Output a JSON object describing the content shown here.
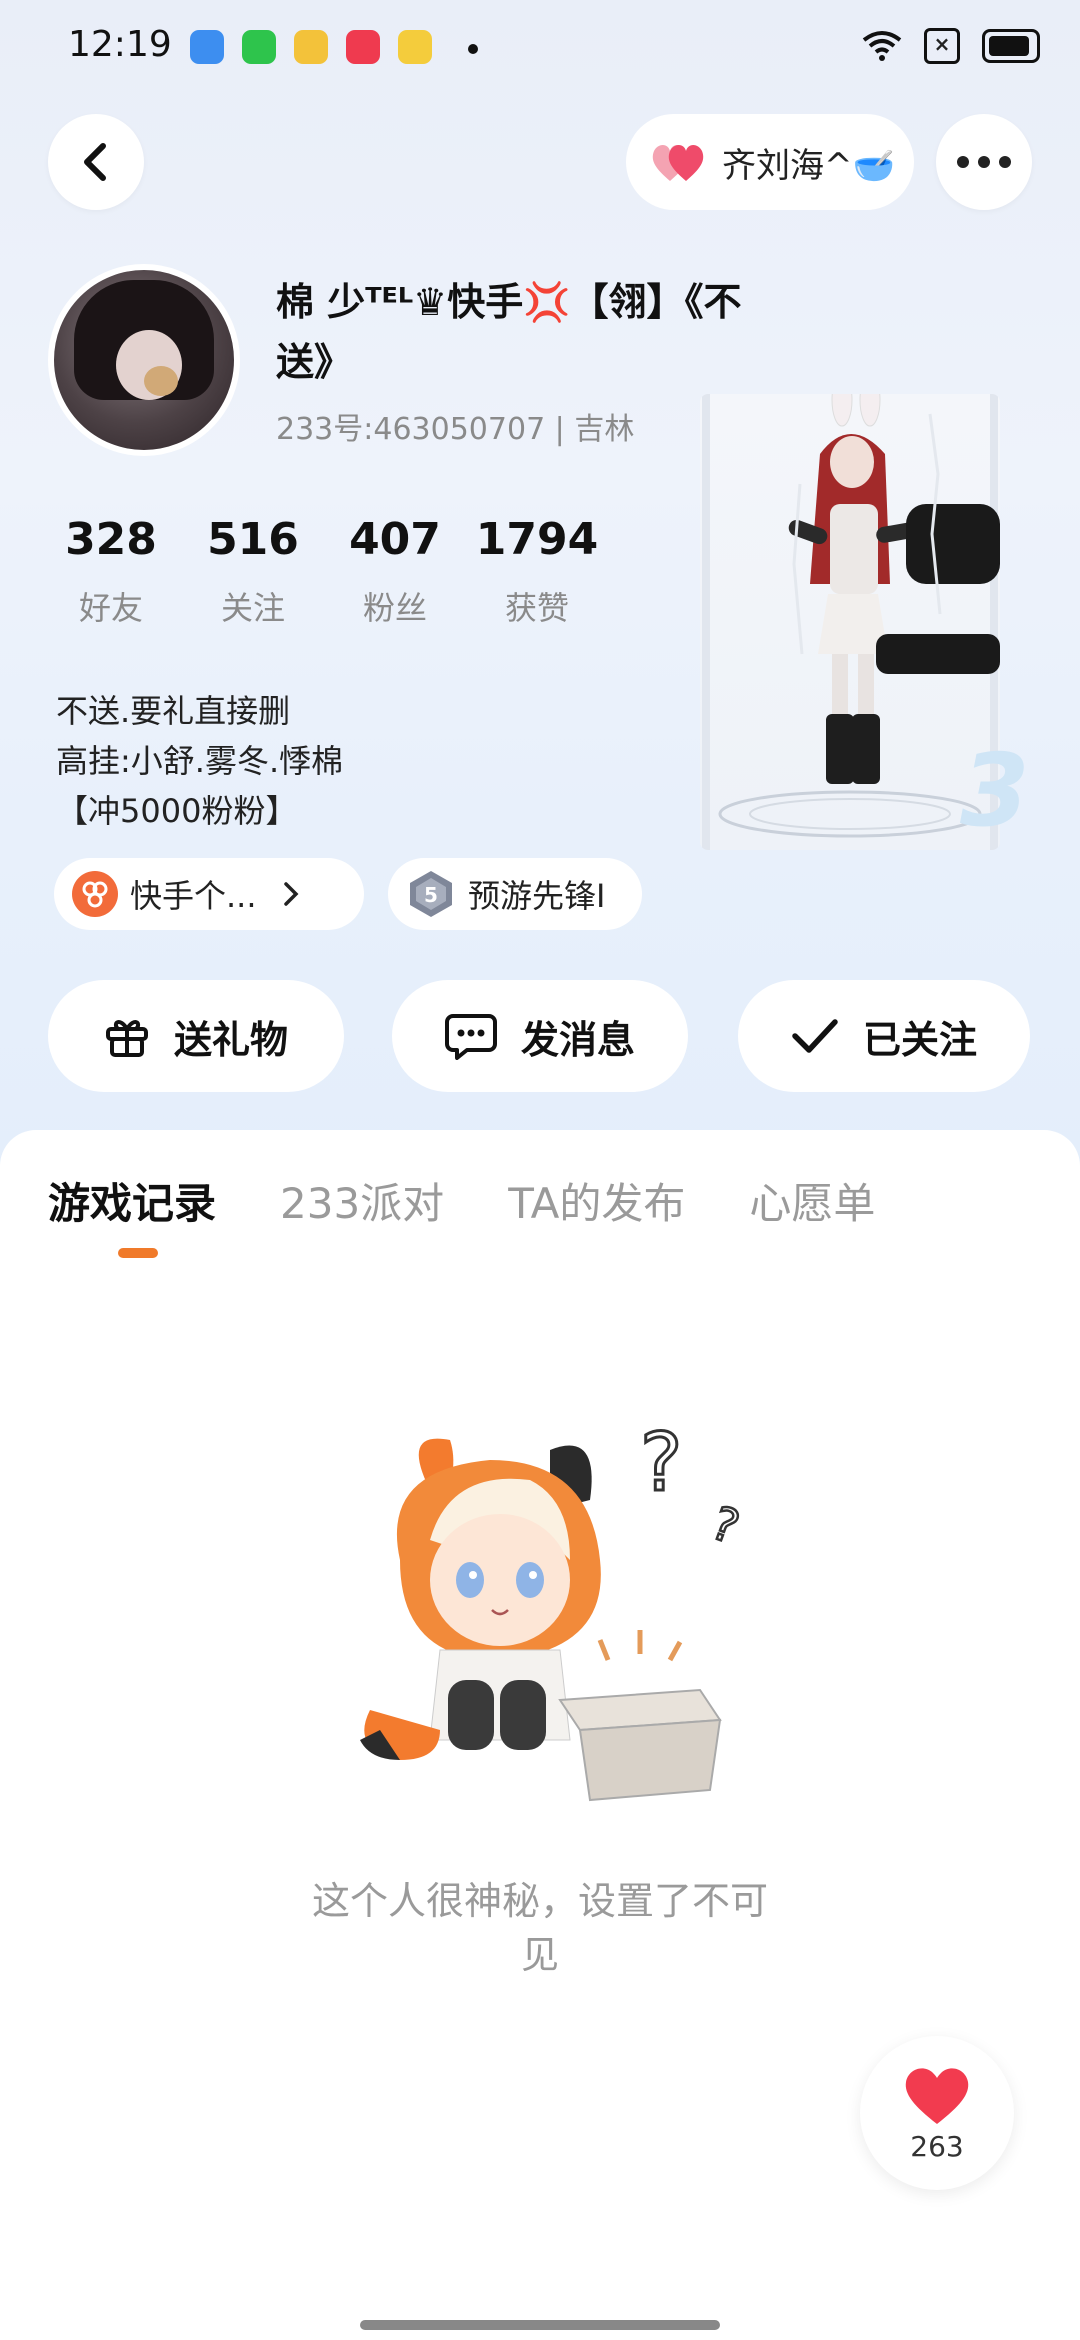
{
  "status_bar": {
    "time": "12:19"
  },
  "header": {
    "user_pill_name": "齐刘海^🥣"
  },
  "profile": {
    "nickname": "棉 少ᵀᴱᴸ♛快手💢【翎】《不送》",
    "uid_line": "233号:463050707 | 吉林",
    "stats": [
      {
        "value": "328",
        "label": "好友"
      },
      {
        "value": "516",
        "label": "关注"
      },
      {
        "value": "407",
        "label": "粉丝"
      },
      {
        "value": "1794",
        "label": "获赞"
      }
    ],
    "bio_lines": [
      "不送.要礼直接删",
      "高挂:小舒.雾冬.悸棉",
      "【冲5000粉粉】"
    ],
    "tags": {
      "kuaishou": "快手个...",
      "pioneer": "预游先锋I"
    }
  },
  "actions": {
    "gift": "送礼物",
    "message": "发消息",
    "followed": "已关注"
  },
  "tabs": [
    "游戏记录",
    "233派对",
    "TA的发布",
    "心愿单"
  ],
  "empty_state": {
    "message": "这个人很神秘，设置了不可见"
  },
  "like_fab": {
    "count": "263"
  },
  "colors": {
    "accent": "#f07a2a",
    "heart": "#f23b4f"
  }
}
